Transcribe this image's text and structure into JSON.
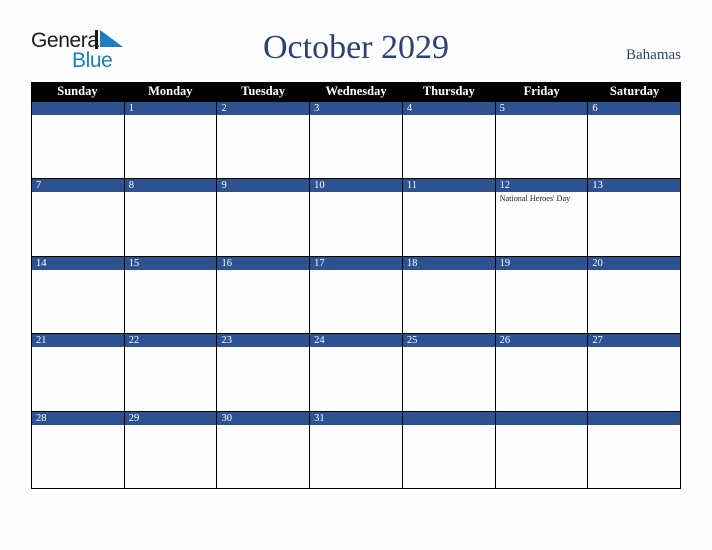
{
  "brand": {
    "name_part1": "General",
    "name_part2": "Blue",
    "mark_color": "#1b7dc4"
  },
  "header": {
    "title": "October 2029",
    "country": "Bahamas"
  },
  "theme": {
    "header_bg": "#000000",
    "day_band": "#2c5291",
    "title_color": "#2e4272",
    "page_bg": "#fdfdfd",
    "border": "#000000"
  },
  "calendar": {
    "weekdays": [
      "Sunday",
      "Monday",
      "Tuesday",
      "Wednesday",
      "Thursday",
      "Friday",
      "Saturday"
    ],
    "weeks": [
      [
        {
          "date": "",
          "events": []
        },
        {
          "date": "1",
          "events": []
        },
        {
          "date": "2",
          "events": []
        },
        {
          "date": "3",
          "events": []
        },
        {
          "date": "4",
          "events": []
        },
        {
          "date": "5",
          "events": []
        },
        {
          "date": "6",
          "events": []
        }
      ],
      [
        {
          "date": "7",
          "events": []
        },
        {
          "date": "8",
          "events": []
        },
        {
          "date": "9",
          "events": []
        },
        {
          "date": "10",
          "events": []
        },
        {
          "date": "11",
          "events": []
        },
        {
          "date": "12",
          "events": [
            "National Heroes' Day"
          ]
        },
        {
          "date": "13",
          "events": []
        }
      ],
      [
        {
          "date": "14",
          "events": []
        },
        {
          "date": "15",
          "events": []
        },
        {
          "date": "16",
          "events": []
        },
        {
          "date": "17",
          "events": []
        },
        {
          "date": "18",
          "events": []
        },
        {
          "date": "19",
          "events": []
        },
        {
          "date": "20",
          "events": []
        }
      ],
      [
        {
          "date": "21",
          "events": []
        },
        {
          "date": "22",
          "events": []
        },
        {
          "date": "23",
          "events": []
        },
        {
          "date": "24",
          "events": []
        },
        {
          "date": "25",
          "events": []
        },
        {
          "date": "26",
          "events": []
        },
        {
          "date": "27",
          "events": []
        }
      ],
      [
        {
          "date": "28",
          "events": []
        },
        {
          "date": "29",
          "events": []
        },
        {
          "date": "30",
          "events": []
        },
        {
          "date": "31",
          "events": []
        },
        {
          "date": "",
          "events": []
        },
        {
          "date": "",
          "events": []
        },
        {
          "date": "",
          "events": []
        }
      ]
    ]
  }
}
